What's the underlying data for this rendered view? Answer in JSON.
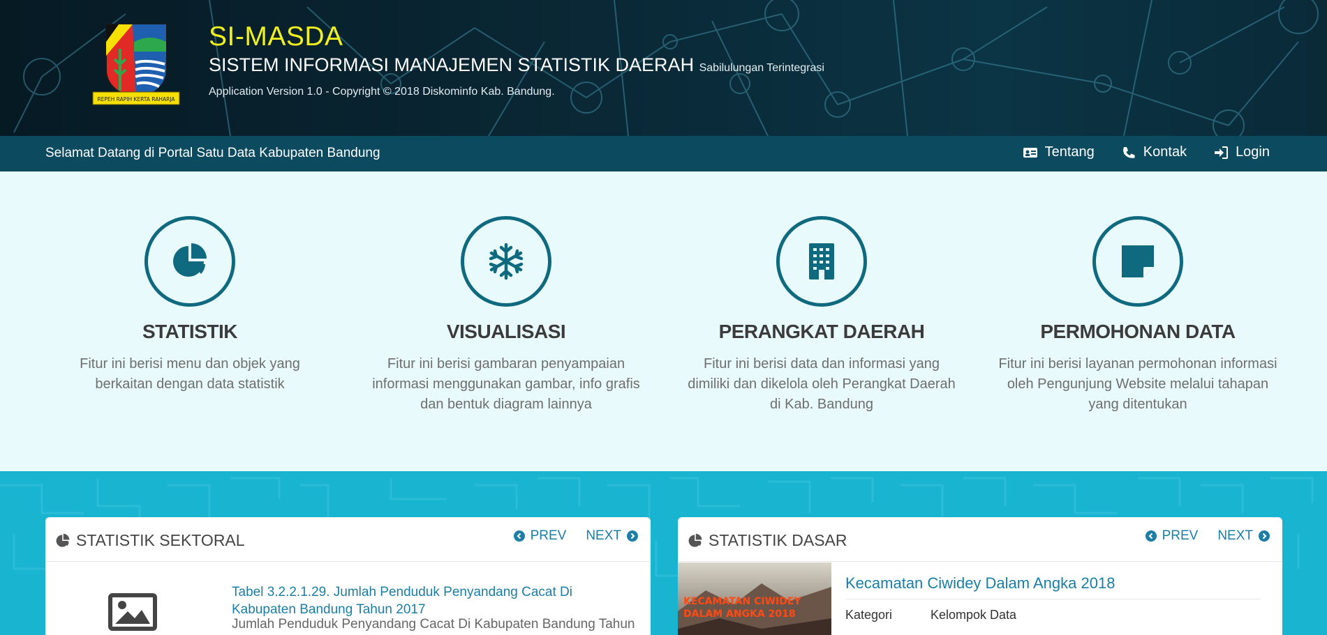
{
  "header": {
    "title": "SI-MASDA",
    "subtitle": "SISTEM INFORMASI MANAJEMEN STATISTIK DAERAH",
    "subtitle_small": "Sabilulungan Terintegrasi",
    "copyright": "Application Version 1.0 - Copyright © 2018 Diskominfo Kab. Bandung.",
    "logo_motto": "REPEH RAPIH KERTA RAHARJA"
  },
  "navbar": {
    "welcome": "Selamat Datang di Portal Satu Data Kabupaten Bandung",
    "links": [
      {
        "label": "Tentang",
        "icon": "id-card-icon"
      },
      {
        "label": "Kontak",
        "icon": "phone-icon"
      },
      {
        "label": "Login",
        "icon": "sign-in-icon"
      }
    ]
  },
  "features": [
    {
      "title": "STATISTIK",
      "desc": "Fitur ini berisi menu dan objek yang berkaitan dengan data statistik",
      "icon": "pie-chart-icon"
    },
    {
      "title": "VISUALISASI",
      "desc": "Fitur ini berisi gambaran penyampaian informasi menggunakan gambar, info grafis dan bentuk diagram lainnya",
      "icon": "snowflake-icon"
    },
    {
      "title": "PERANGKAT DAERAH",
      "desc": "Fitur ini berisi data dan informasi yang dimiliki dan dikelola oleh Perangkat Daerah di Kab. Bandung",
      "icon": "building-icon"
    },
    {
      "title": "PERMOHONAN DATA",
      "desc": "Fitur ini berisi layanan permohonan informasi oleh Pengunjung Website melalui tahapan yang ditentukan",
      "icon": "sticky-note-icon"
    }
  ],
  "cards": {
    "sektoral": {
      "title": "STATISTIK SEKTORAL",
      "prev": "PREV",
      "next": "NEXT",
      "item_title": "Tabel 3.2.2.1.29. Jumlah Penduduk Penyandang Cacat Di Kabupaten Bandung Tahun 2017",
      "item_desc": "Jumlah Penduduk Penyandang Cacat Di Kabupaten Bandung Tahun"
    },
    "dasar": {
      "title": "STATISTIK DASAR",
      "prev": "PREV",
      "next": "NEXT",
      "book_title": "Kecamatan Ciwidey Dalam Angka 2018",
      "cover_text": "KECAMATAN CIWIDEY DALAM ANGKA 2018",
      "row_key": "Kategori",
      "row_val": "Kelompok Data",
      "row2_key": "-",
      "row2_val": "-"
    }
  },
  "colors": {
    "accent": "#0f6a7f",
    "navbar": "#0b4a5f",
    "title_yellow": "#f0f01e",
    "link_blue": "#1a7ea6",
    "panel_cyan": "#18b4d0"
  }
}
